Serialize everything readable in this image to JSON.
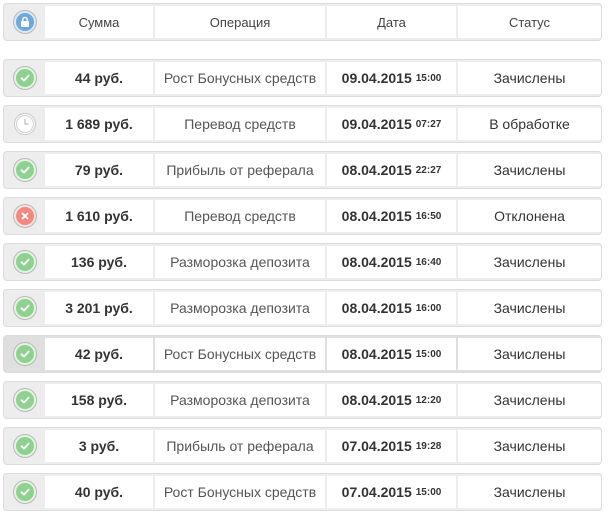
{
  "header": {
    "sum": "Сумма",
    "operation": "Операция",
    "date": "Дата",
    "status": "Статус"
  },
  "icons": {
    "header": "lock-icon",
    "completed": "check-icon",
    "pending": "clock-icon",
    "rejected": "cross-icon"
  },
  "colors": {
    "success": "#8fd18f",
    "danger": "#f08a80",
    "info": "#6fa8dc"
  },
  "rows": [
    {
      "icon": "completed",
      "amount": "44 руб.",
      "operation": "Рост Бонусных средств",
      "date": "09.04.2015",
      "time": "15:00",
      "status": "Зачислены"
    },
    {
      "icon": "pending",
      "amount": "1 689 руб.",
      "operation": "Перевод средств",
      "date": "09.04.2015",
      "time": "07:27",
      "status": "В обработке"
    },
    {
      "icon": "completed",
      "amount": "79 руб.",
      "operation": "Прибыль от реферала",
      "date": "08.04.2015",
      "time": "22:27",
      "status": "Зачислены"
    },
    {
      "icon": "rejected",
      "amount": "1 610 руб.",
      "operation": "Перевод средств",
      "date": "08.04.2015",
      "time": "16:50",
      "status": "Отклонена"
    },
    {
      "icon": "completed",
      "amount": "136 руб.",
      "operation": "Разморозка депозита",
      "date": "08.04.2015",
      "time": "16:40",
      "status": "Зачислены"
    },
    {
      "icon": "completed",
      "amount": "3 201 руб.",
      "operation": "Разморозка депозита",
      "date": "08.04.2015",
      "time": "16:00",
      "status": "Зачислены"
    },
    {
      "icon": "completed",
      "amount": "42 руб.",
      "operation": "Рост Бонусных средств",
      "date": "08.04.2015",
      "time": "15:00",
      "status": "Зачислены"
    },
    {
      "icon": "completed",
      "amount": "158 руб.",
      "operation": "Разморозка депозита",
      "date": "08.04.2015",
      "time": "12:20",
      "status": "Зачислены"
    },
    {
      "icon": "completed",
      "amount": "3 руб.",
      "operation": "Прибыль от реферала",
      "date": "07.04.2015",
      "time": "19:28",
      "status": "Зачислены"
    },
    {
      "icon": "completed",
      "amount": "40 руб.",
      "operation": "Рост Бонусных средств",
      "date": "07.04.2015",
      "time": "15:00",
      "status": "Зачислены"
    }
  ]
}
